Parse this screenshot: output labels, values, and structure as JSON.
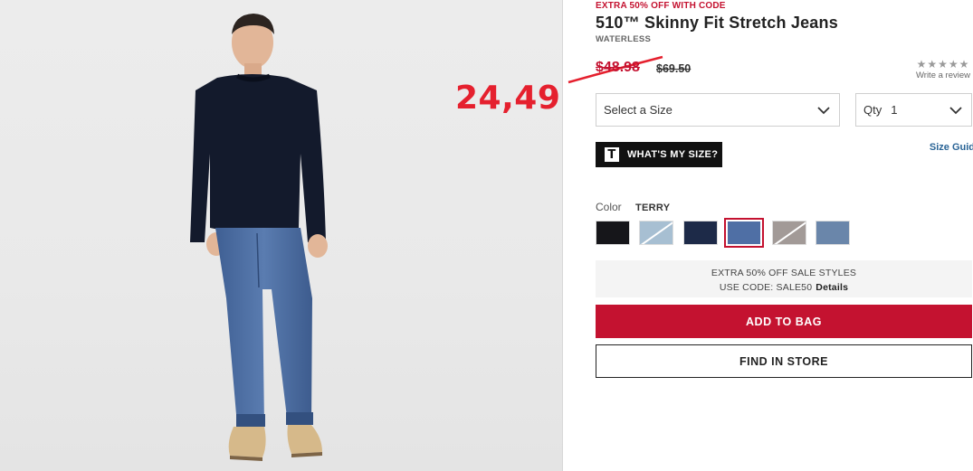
{
  "annotation": {
    "handwritten_price": "24,49",
    "color": "#e5202e"
  },
  "product": {
    "promo_line": "EXTRA 50% OFF WITH CODE",
    "title": "510™ Skinny Fit Stretch Jeans",
    "subtitle": "WATERLESS",
    "sale_price": "$48.98",
    "original_price": "$69.50",
    "rating": {
      "stars": 0,
      "max": 5,
      "write_review": "Write a review"
    }
  },
  "size_select": {
    "value": "Select a Size",
    "icon": "chevron-down-icon"
  },
  "qty_select": {
    "label": "Qty",
    "value": "1",
    "icon": "chevron-down-icon"
  },
  "whats_my_size": {
    "logo": "T",
    "label": "WHAT'S MY SIZE?"
  },
  "size_guide": "Size Guid",
  "color": {
    "label": "Color",
    "selected_name": "TERRY",
    "swatches": [
      {
        "name": "black",
        "color": "#16161a",
        "unavailable": false
      },
      {
        "name": "light-stonewash",
        "color": "#a7bfd2",
        "unavailable": true
      },
      {
        "name": "navy",
        "color": "#1d2a48",
        "unavailable": false
      },
      {
        "name": "terry",
        "color": "#4f6fa5",
        "unavailable": false,
        "selected": true
      },
      {
        "name": "grey",
        "color": "#a29a97",
        "unavailable": true
      },
      {
        "name": "mid-blue",
        "color": "#6a86aa",
        "unavailable": false
      }
    ]
  },
  "promo_box": {
    "line1": "EXTRA 50% OFF SALE STYLES",
    "line2": "USE CODE: SALE50",
    "details": "Details"
  },
  "buttons": {
    "add_to_bag": "ADD TO BAG",
    "find_in_store": "FIND IN STORE"
  },
  "colors": {
    "accent": "#c41230",
    "link": "#2a6496"
  }
}
